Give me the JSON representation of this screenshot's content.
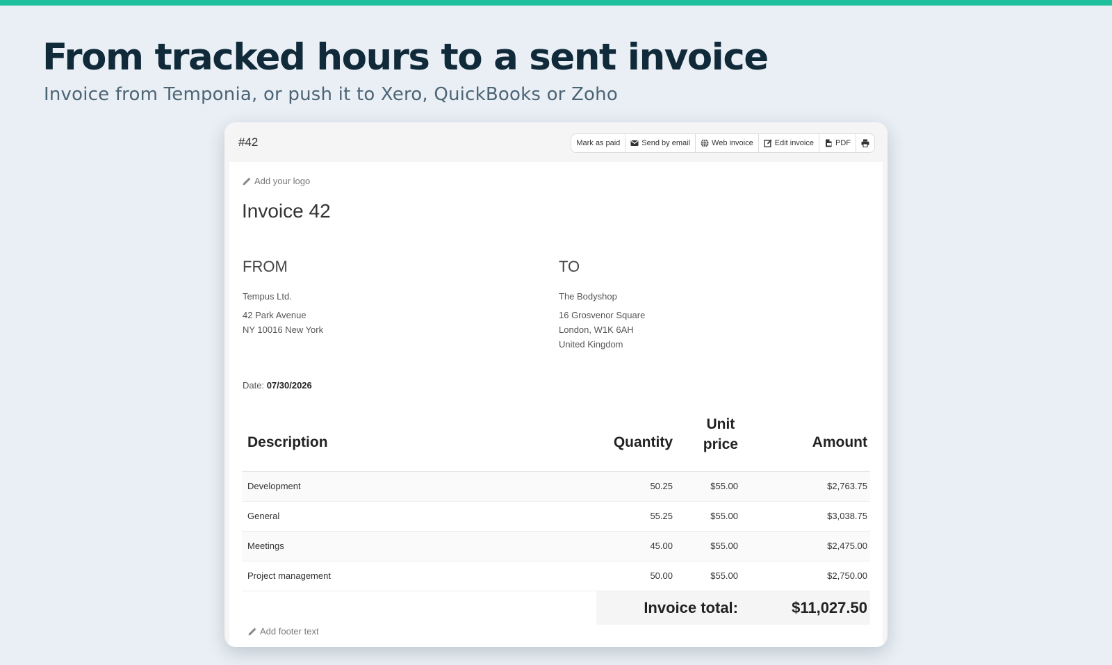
{
  "page": {
    "headline": "From tracked hours to a sent invoice",
    "subheadline": "Invoice from Temponia, or push it to Xero, QuickBooks or Zoho"
  },
  "toolbar": {
    "invoice_number": "#42",
    "mark_paid": "Mark as paid",
    "send_email": "Send by email",
    "web_invoice": "Web invoice",
    "edit_invoice": "Edit invoice",
    "pdf": "PDF"
  },
  "invoice": {
    "add_logo": "Add your logo",
    "title": "Invoice 42",
    "from": {
      "heading": "FROM",
      "name": "Tempus Ltd.",
      "line1": "42 Park Avenue",
      "line2": "NY 10016 New York"
    },
    "to": {
      "heading": "TO",
      "name": "The Bodyshop",
      "line1": "16 Grosvenor Square",
      "line2": "London, W1K 6AH",
      "line3": "United Kingdom"
    },
    "date_label": "Date:",
    "date_value": "07/30/2026",
    "columns": {
      "description": "Description",
      "quantity": "Quantity",
      "unit_line1": "Unit",
      "unit_line2": "price",
      "amount": "Amount"
    },
    "rows": [
      {
        "description": "Development",
        "quantity": "50.25",
        "unit_price": "$55.00",
        "amount": "$2,763.75"
      },
      {
        "description": "General",
        "quantity": "55.25",
        "unit_price": "$55.00",
        "amount": "$3,038.75"
      },
      {
        "description": "Meetings",
        "quantity": "45.00",
        "unit_price": "$55.00",
        "amount": "$2,475.00"
      },
      {
        "description": "Project management",
        "quantity": "50.00",
        "unit_price": "$55.00",
        "amount": "$2,750.00"
      }
    ],
    "total_label": "Invoice total:",
    "total_value": "$11,027.50",
    "add_footer": "Add footer text"
  },
  "colors": {
    "accent": "#1fbf9c",
    "background": "#e9eff5",
    "headline": "#102a3a"
  },
  "icons": {
    "mark_paid": "none",
    "send_email": "envelope-icon",
    "web_invoice": "globe-icon",
    "edit_invoice": "edit-icon",
    "pdf": "pdf-file-icon",
    "print": "printer-icon",
    "add_logo": "pencil-icon",
    "add_footer": "pencil-icon"
  }
}
